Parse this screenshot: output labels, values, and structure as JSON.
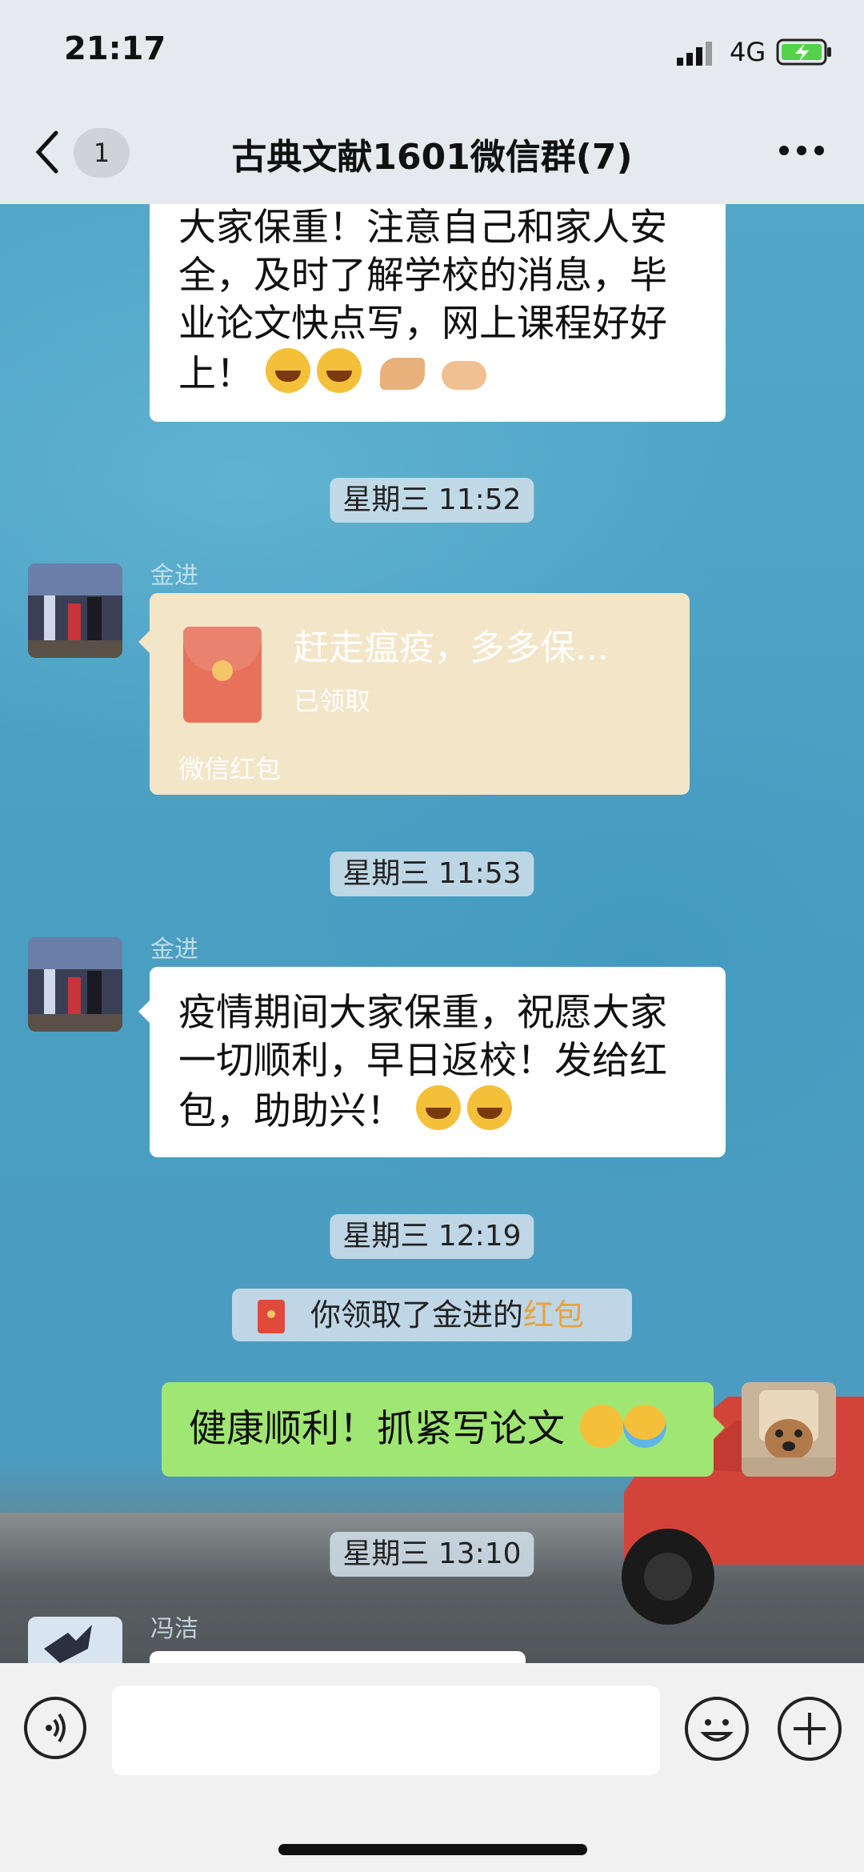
{
  "status_bar": {
    "time": "21:17",
    "network": "4G"
  },
  "nav": {
    "badge": "1",
    "title": "古典文献1601微信群(7)"
  },
  "messages": {
    "m1": {
      "lines": [
        "大家保重！注意自己和家人安",
        "全，及时了解学校的消息，毕",
        "业论文快点写，网上课程好好",
        "上！"
      ]
    },
    "ts1": "星期三 11:52",
    "m2": {
      "sender": "金进",
      "red_packet": {
        "title": "赶走瘟疫，多多保...",
        "status": "已领取",
        "footer": "微信红包"
      }
    },
    "ts2": "星期三 11:53",
    "m3": {
      "sender": "金进",
      "lines": [
        "疫情期间大家保重，祝愿大家",
        "一切顺利，早日返校！发给红",
        "包，助助兴！"
      ]
    },
    "ts3": "星期三 12:19",
    "system": {
      "prefix": "你领取了金进的",
      "highlight": "红包"
    },
    "m4": {
      "text": "健康顺利！抓紧写论文"
    },
    "ts4": "星期三 13:10",
    "m5": {
      "sender": "冯洁"
    }
  },
  "icons": {
    "back": "chevron-left-icon",
    "more": "more-dots-icon",
    "voice": "voice-icon",
    "emoji": "emoji-icon",
    "plus": "plus-icon"
  }
}
